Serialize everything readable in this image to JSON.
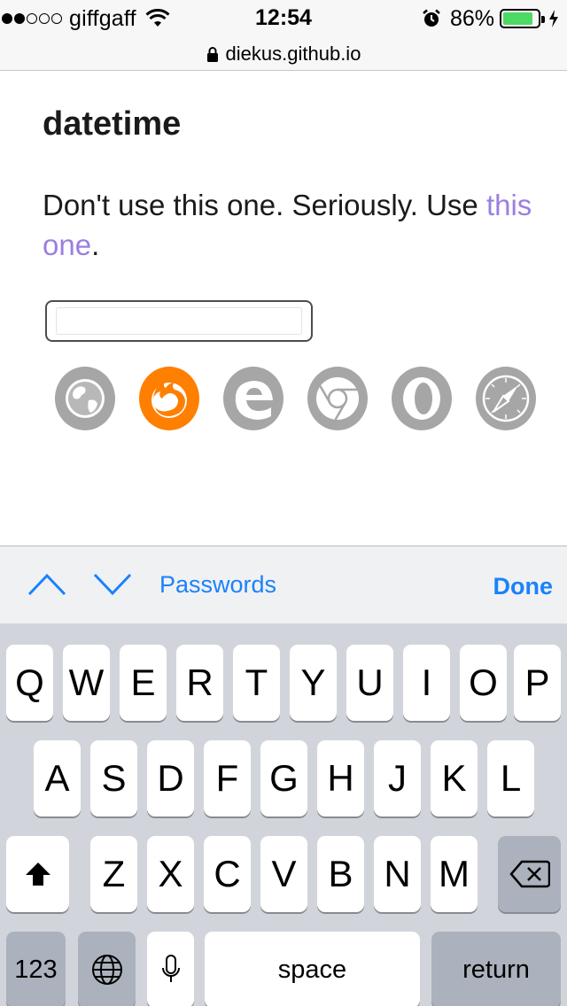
{
  "status_bar": {
    "carrier": "giffgaff",
    "signal_filled": 2,
    "signal_total": 5,
    "time": "12:54",
    "battery": "86%",
    "battery_level": 0.86,
    "icons": [
      "wifi-icon",
      "alarm-icon",
      "battery-icon",
      "charging-bolt-icon"
    ]
  },
  "url_bar": {
    "url": "diekus.github.io",
    "icon": "lock-icon"
  },
  "page": {
    "title": "datetime",
    "text_before": "Don't use this one. Seriously. Use ",
    "link_text": "this one",
    "text_after": ".",
    "link_color": "#9b7fe0",
    "input_value": "",
    "browsers": [
      {
        "name": "web-browser",
        "color": "#a6a6a6"
      },
      {
        "name": "firefox",
        "color": "#ff7f00"
      },
      {
        "name": "edge",
        "color": "#a6a6a6"
      },
      {
        "name": "chrome",
        "color": "#a6a6a6"
      },
      {
        "name": "opera",
        "color": "#a6a6a6"
      },
      {
        "name": "safari",
        "color": "#a6a6a6"
      }
    ]
  },
  "accessory_bar": {
    "passwords": "Passwords",
    "done": "Done",
    "accent": "#1a82fb"
  },
  "keyboard": {
    "row1": [
      "Q",
      "W",
      "E",
      "R",
      "T",
      "Y",
      "U",
      "I",
      "O",
      "P"
    ],
    "row2": [
      "A",
      "S",
      "D",
      "F",
      "G",
      "H",
      "J",
      "K",
      "L"
    ],
    "row3": [
      "Z",
      "X",
      "C",
      "V",
      "B",
      "N",
      "M"
    ],
    "numbers": "123",
    "space": "space",
    "return": "return"
  }
}
